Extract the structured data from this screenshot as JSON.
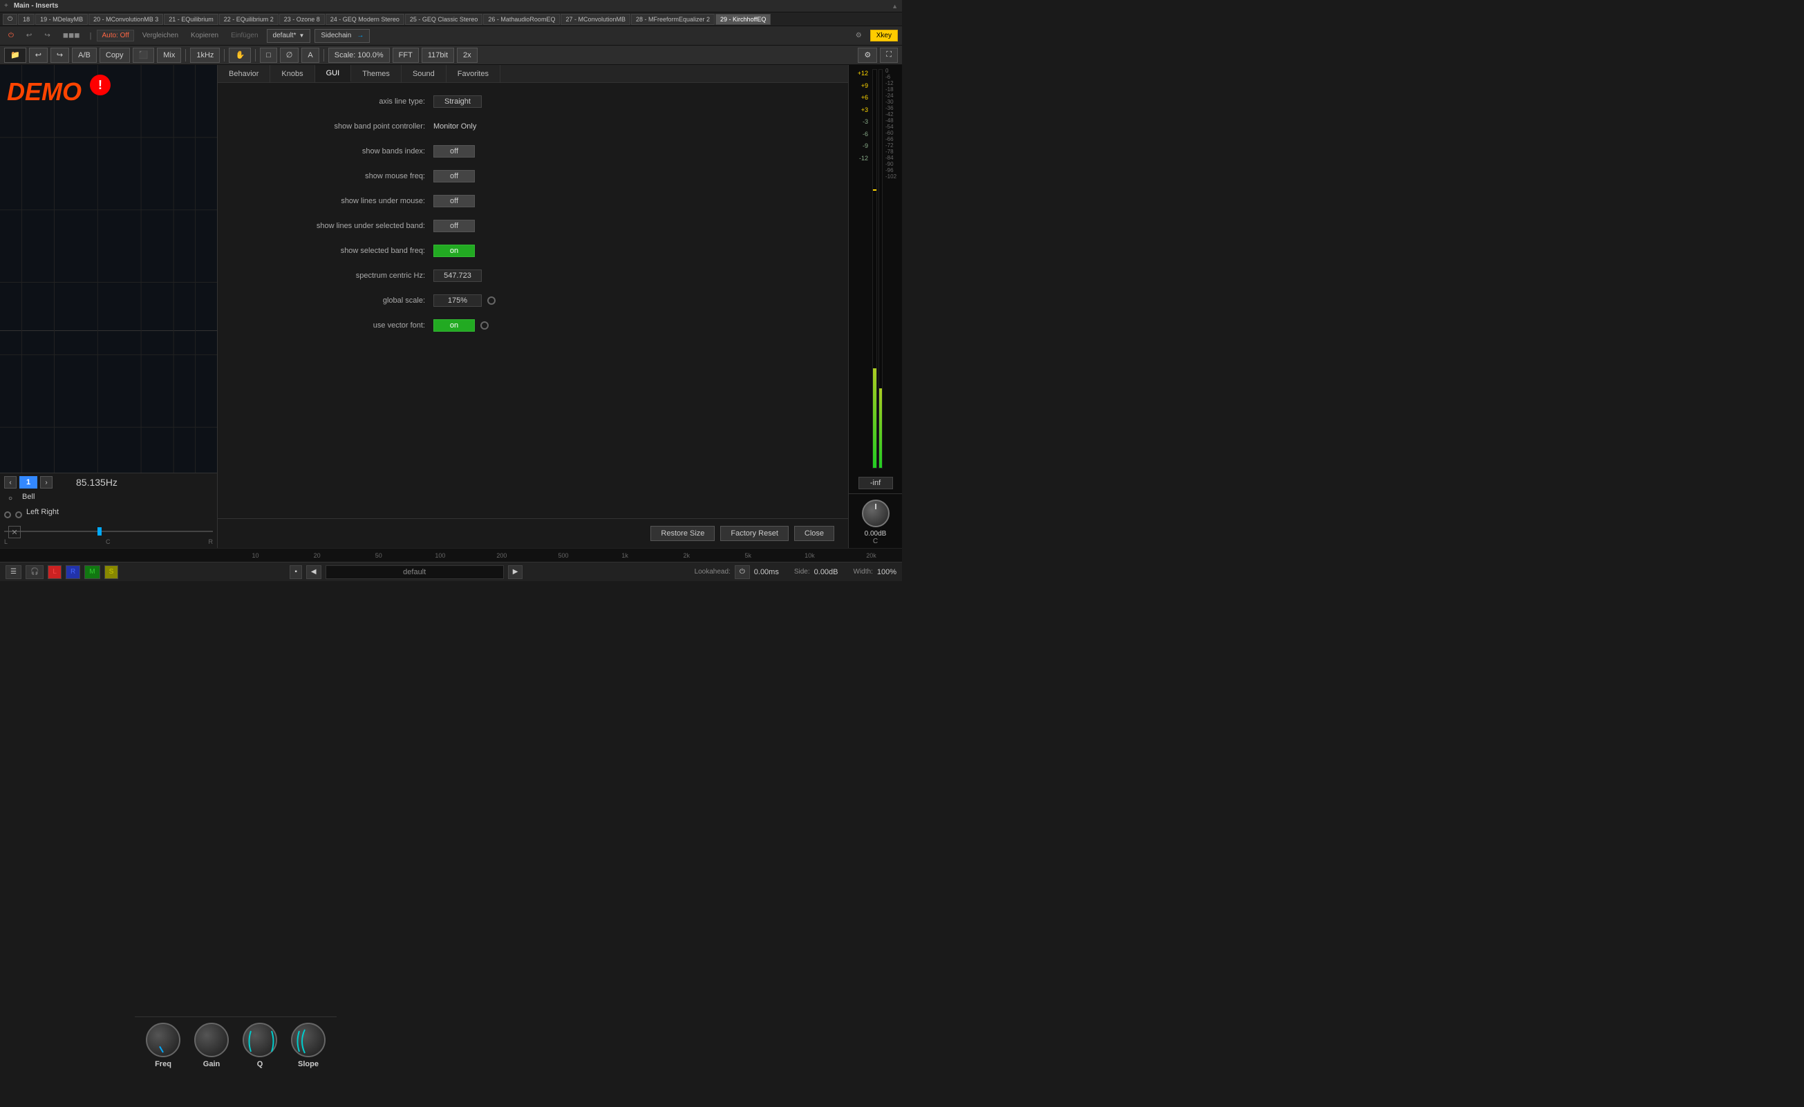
{
  "window": {
    "title": "Main - Inserts"
  },
  "plugin_tabs": [
    {
      "id": "18",
      "label": "18"
    },
    {
      "id": "19",
      "label": "19 - MDelayMB"
    },
    {
      "id": "20",
      "label": "20 - MConvolutionMB 3"
    },
    {
      "id": "21",
      "label": "21 - EQuilibrium"
    },
    {
      "id": "22",
      "label": "22 - EQuilibrium 2"
    },
    {
      "id": "23",
      "label": "23 - Ozone 8"
    },
    {
      "id": "24",
      "label": "24 - GEQ Modern Stereo"
    },
    {
      "id": "25",
      "label": "25 - GEQ Classic Stereo"
    },
    {
      "id": "26",
      "label": "26 - MathaudioRoomEQ"
    },
    {
      "id": "27",
      "label": "27 - MConvolutionMB"
    },
    {
      "id": "28",
      "label": "28 - MFreeformEqualizer 2"
    },
    {
      "id": "29",
      "label": "29 - KirchhoffEQ",
      "active": true
    }
  ],
  "secondary_toolbar": {
    "auto_off": "Auto: Off",
    "vergleichen": "Vergleichen",
    "kopieren": "Kopieren",
    "einfugen": "Einfügen",
    "default": "default*",
    "sidechain": "Sidechain",
    "gear_btn": "⚙",
    "xkey": "Xkey"
  },
  "main_toolbar": {
    "ab_label": "A/B",
    "copy_label": "Copy",
    "mix_label": "Mix",
    "freq_label": "1kHz",
    "scale_label": "Scale: 100.0%",
    "fft_label": "FFT",
    "bit_label": "117bit",
    "x2_label": "2x"
  },
  "settings_tabs": [
    {
      "id": "behavior",
      "label": "Behavior"
    },
    {
      "id": "knobs",
      "label": "Knobs"
    },
    {
      "id": "gui",
      "label": "GUI",
      "active": true
    },
    {
      "id": "themes",
      "label": "Themes"
    },
    {
      "id": "sound",
      "label": "Sound"
    },
    {
      "id": "favorites",
      "label": "Favorites"
    }
  ],
  "gui_settings": {
    "axis_line_type": {
      "label": "axis line type:",
      "value": "Straight"
    },
    "show_band_point_controller": {
      "label": "show band point controller:",
      "value": "Monitor Only"
    },
    "show_bands_index": {
      "label": "show bands index:",
      "value": "off",
      "state": "off"
    },
    "show_mouse_freq": {
      "label": "show mouse freq:",
      "value": "off",
      "state": "off"
    },
    "show_lines_under_mouse": {
      "label": "show lines under mouse:",
      "value": "off",
      "state": "off"
    },
    "show_lines_under_selected_band": {
      "label": "show lines under selected band:",
      "value": "off",
      "state": "off"
    },
    "show_selected_band_freq": {
      "label": "show selected band freq:",
      "value": "on",
      "state": "on"
    },
    "spectrum_centric_hz": {
      "label": "spectrum centric Hz:",
      "value": "547.723"
    },
    "global_scale": {
      "label": "global scale:",
      "value": "175%"
    },
    "use_vector_font": {
      "label": "use vector font:",
      "value": "on",
      "state": "on"
    }
  },
  "actions": {
    "restore_size": "Restore Size",
    "factory_reset": "Factory Reset",
    "close": "Close"
  },
  "eq_controls": {
    "band_number": "1",
    "freq_display": "85.135Hz",
    "filter_type": "Bell",
    "channel": "Left Right",
    "pan_labels": [
      "L",
      "C",
      "R"
    ]
  },
  "knobs": [
    {
      "id": "freq",
      "label": "Freq"
    },
    {
      "id": "gain",
      "label": "Gain"
    },
    {
      "id": "q",
      "label": "Q"
    },
    {
      "id": "slope",
      "label": "Slope"
    }
  ],
  "meter": {
    "scale": [
      "+12",
      "+9",
      "+6",
      "+3",
      "-3",
      "-6",
      "-9",
      "-12"
    ],
    "db_labels": [
      "0",
      "-6",
      "-12",
      "-18",
      "-24",
      "-30",
      "-36",
      "-42",
      "-48",
      "-54",
      "-60",
      "-66",
      "-72",
      "-78",
      "-84",
      "-90",
      "-96",
      "-102"
    ],
    "gain_value": "0.00dB",
    "channel": "C",
    "inf_label": "-inf"
  },
  "bottom_toolbar": {
    "preset_name": "default",
    "lookahead_label": "Lookahead:",
    "lookahead_value": "0.00ms",
    "side_label": "Side:",
    "side_value": "0.00dB",
    "width_label": "Width:",
    "width_value": "100%"
  },
  "freq_axis": [
    "10",
    "20",
    "50",
    "100",
    "200",
    "500",
    "1k",
    "2k",
    "5k",
    "10k",
    "20k"
  ]
}
